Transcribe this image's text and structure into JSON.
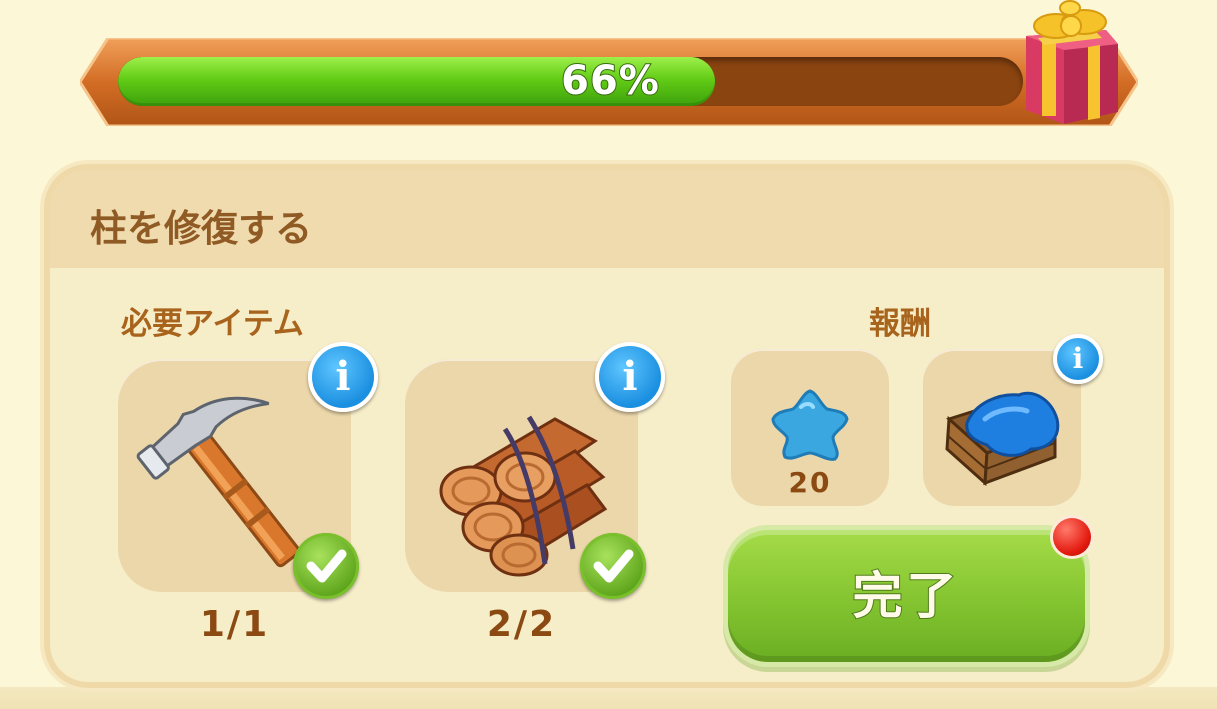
{
  "progress": {
    "percent": 66,
    "label": "66%"
  },
  "task": {
    "title": "柱を修復する"
  },
  "required": {
    "heading": "必要アイテム",
    "items": [
      {
        "name": "hammer",
        "icon": "hammer-icon",
        "count": "1/1",
        "complete": true
      },
      {
        "name": "logs",
        "icon": "wood-logs-icon",
        "count": "2/2",
        "complete": true
      }
    ]
  },
  "rewards": {
    "heading": "報酬",
    "items": [
      {
        "icon": "blue-star-icon",
        "count": "20"
      },
      {
        "icon": "blue-cloth-crate-icon",
        "count": ""
      }
    ]
  },
  "actions": {
    "complete_label": "完了"
  },
  "colors": {
    "accent_green": "#86c632",
    "progress_green": "#62cc16",
    "title_brown": "#8f5a24",
    "info_blue": "#1b8fe0"
  }
}
